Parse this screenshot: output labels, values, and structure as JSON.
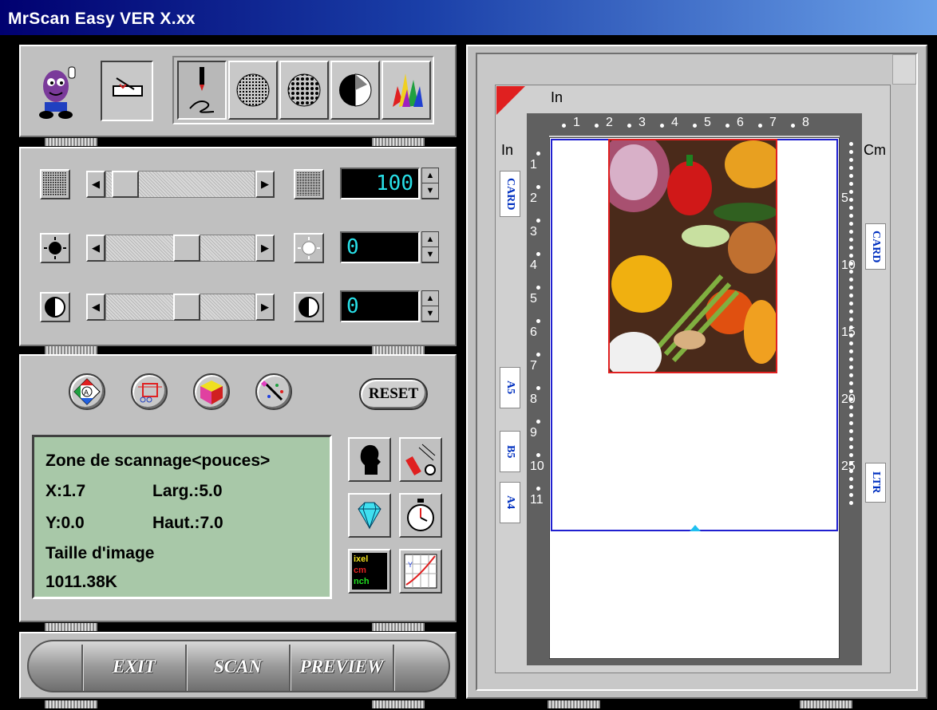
{
  "window": {
    "title": "MrScan Easy VER X.xx"
  },
  "toolbar": {
    "icons": [
      "mascot-icon",
      "scanner-icon",
      "line-art-icon",
      "halftone-icon",
      "dither-icon",
      "grayscale-icon",
      "color-icon"
    ]
  },
  "sliders": {
    "resolution": {
      "value": "100",
      "level": 0.05
    },
    "brightness": {
      "value": "0",
      "level": 0.55
    },
    "contrast": {
      "value": "0",
      "level": 0.55
    }
  },
  "tools": {
    "reset_label": "RESET"
  },
  "info": {
    "heading": "Zone de scannage<pouces>",
    "x": "X:1.7",
    "width": "Larg.:5.0",
    "y": "Y:0.0",
    "height": "Haut.:7.0",
    "size_label": "Taille d'image",
    "size_value": "1011.38K"
  },
  "units_icon": {
    "line1": "ixel",
    "line2": "cm",
    "line3": "nch"
  },
  "bottom": {
    "exit": "EXIT",
    "scan": "SCAN",
    "preview": "PREVIEW"
  },
  "preview": {
    "top_unit": "In",
    "left_unit": "In",
    "right_unit": "Cm",
    "top_ticks": [
      "1",
      "2",
      "3",
      "4",
      "5",
      "6",
      "7",
      "8"
    ],
    "left_ticks": [
      "1",
      "2",
      "3",
      "4",
      "5",
      "6",
      "7",
      "8",
      "9",
      "10",
      "11"
    ],
    "right_ticks": [
      "5",
      "10",
      "15",
      "20",
      "25"
    ],
    "left_papers": [
      "CARD",
      "A5",
      "B5",
      "A4"
    ],
    "right_papers": [
      "CARD",
      "LTR"
    ]
  },
  "colors": {
    "lcd_text": "#28e0e8",
    "info_bg": "#a8c8a8",
    "selection": "#e02020",
    "scan_area": "#2020d0"
  }
}
